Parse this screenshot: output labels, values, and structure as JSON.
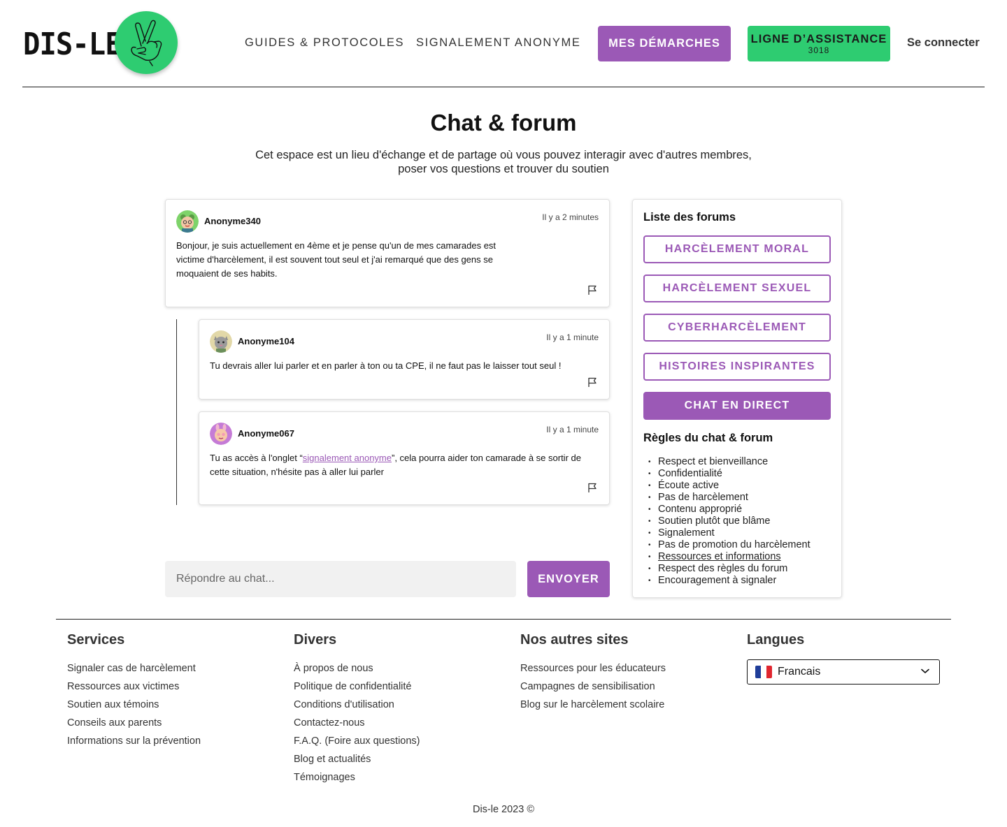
{
  "header": {
    "logo_text": "DIS-LE",
    "logo_icon": "crossed-fingers-hand-icon",
    "nav": {
      "guides": "GUIDES & PROTOCOLES",
      "signalement": "SIGNALEMENT ANONYME",
      "demarches": "MES DÉMARCHES",
      "assistance": "LIGNE D’ASSISTANCE",
      "assistance_number": "3018",
      "login": "Se connecter"
    }
  },
  "page": {
    "title": "Chat & forum",
    "subtitle_line1": "Cet espace est un lieu d'échange et de partage où vous pouvez interagir avec d'autres membres,",
    "subtitle_line2": "poser vos questions et trouver du soutien"
  },
  "posts": [
    {
      "user": "Anonyme340",
      "time": "Il y a 2 minutes",
      "text": "Bonjour, je suis actuellement en 4ème et je pense qu'un de mes camarades est victime d'harcèlement, il est souvent tout seul et j'ai remarqué que des gens se moquaient de ses habits."
    },
    {
      "user": "Anonyme104",
      "time": "Il y a 1 minute",
      "text": "Tu devrais aller lui parler et en parler à ton ou ta CPE, il ne faut pas le laisser tout seul !"
    },
    {
      "user": "Anonyme067",
      "time": "Il y a 1 minute",
      "text_before": "Tu as accès à l'onglet “",
      "link": "signalement anonyme",
      "text_after": "”, cela pourra aider ton camarade à se sortir de cette situation, n'hésite pas à aller lui parler"
    }
  ],
  "reply": {
    "placeholder": "Répondre au chat...",
    "send_label": "ENVOYER"
  },
  "sidebar": {
    "forums_title": "Liste des forums",
    "forums": [
      "HARCÈLEMENT MORAL",
      "HARCÈLEMENT SEXUEL",
      "CYBERHARCÈLEMENT",
      "HISTOIRES INSPIRANTES",
      "CHAT EN DIRECT"
    ],
    "rules_title": "Règles du chat & forum",
    "rules": [
      "Respect et bienveillance",
      "Confidentialité",
      "Écoute active",
      "Pas de harcèlement",
      "Contenu approprié",
      "Soutien plutôt que blâme",
      "Signalement",
      "Pas de promotion du harcèlement",
      "Ressources et informations",
      "Respect des règles du forum",
      "Encouragement à signaler"
    ]
  },
  "footer": {
    "services": {
      "title": "Services",
      "items": [
        "Signaler cas de harcèlement",
        "Ressources aux victimes",
        "Soutien aux témoins",
        "Conseils aux parents",
        "Informations sur la prévention"
      ]
    },
    "divers": {
      "title": "Divers",
      "items": [
        "À propos de nous",
        "Politique de confidentialité",
        "Conditions d'utilisation",
        "Contactez-nous",
        "F.A.Q. (Foire aux questions)",
        "Blog et actualités",
        "Témoignages"
      ]
    },
    "sites": {
      "title": "Nos autres sites",
      "items": [
        "Ressources pour les éducateurs",
        "Campagnes de sensibilisation",
        "Blog sur le harcèlement scolaire"
      ]
    },
    "langues": {
      "title": "Langues",
      "selected": "Francais"
    },
    "copyright": "Dis-le 2023 ©"
  },
  "colors": {
    "accent_purple": "#9b59b6",
    "accent_green": "#2ecc71"
  }
}
